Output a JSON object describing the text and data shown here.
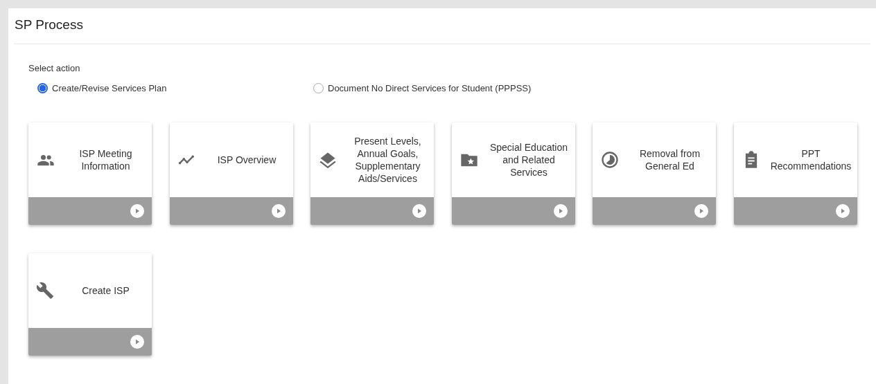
{
  "panel": {
    "title": "SP Process"
  },
  "action": {
    "label": "Select action",
    "options": [
      {
        "label": "Create/Revise Services Plan",
        "selected": true
      },
      {
        "label": "Document No Direct Services for Student (PPPSS)",
        "selected": false
      }
    ]
  },
  "tiles": [
    {
      "kind": "people",
      "label": "ISP Meeting Information"
    },
    {
      "kind": "trend",
      "label": "ISP Overview"
    },
    {
      "kind": "layers",
      "label": "Present Levels, Annual Goals, Supplementary Aids/Services"
    },
    {
      "kind": "folder",
      "label": "Special Education and Related Services"
    },
    {
      "kind": "pie",
      "label": "Removal from General Ed"
    },
    {
      "kind": "clipboard",
      "label": "PPT Recommendations"
    },
    {
      "kind": "wrench",
      "label": "Create ISP"
    }
  ]
}
